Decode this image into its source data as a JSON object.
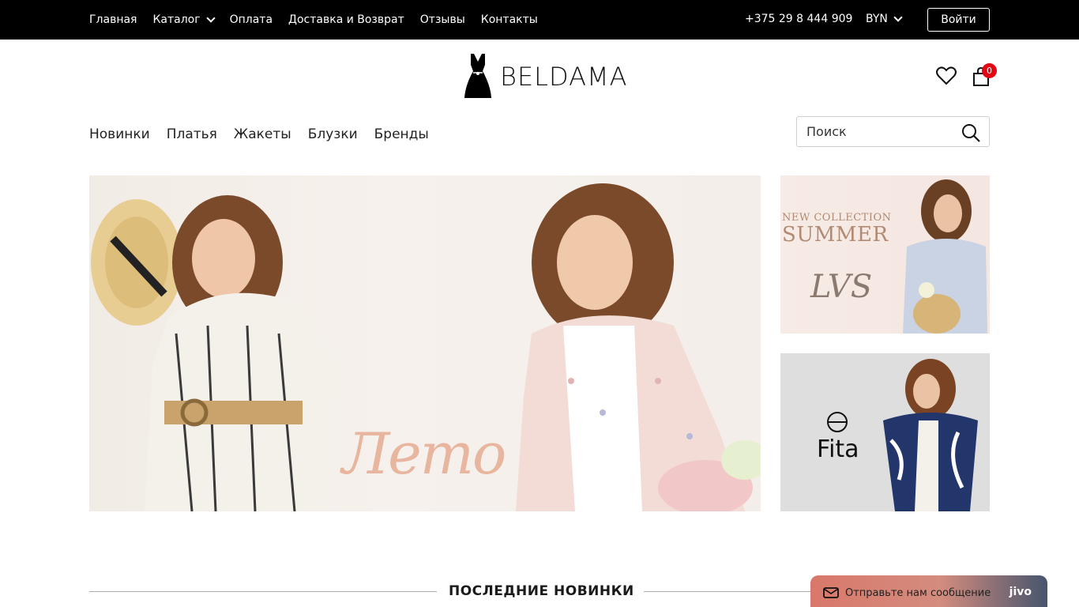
{
  "topbar": {
    "nav": [
      "Главная",
      "Каталог",
      "Оплата",
      "Доставка и Возврат",
      "Отзывы",
      "Контакты"
    ],
    "phone": "+375 29 8 444 909",
    "currency": "BYN",
    "login_label": "Войти"
  },
  "header": {
    "logo_text": "BELDAMA",
    "cart_count": "0"
  },
  "subnav": [
    "Новинки",
    "Платья",
    "Жакеты",
    "Блузки",
    "Бренды"
  ],
  "search": {
    "placeholder": "Поиск"
  },
  "banners": {
    "hero_text": "Лето",
    "side1_line1": "NEW COLLECTION",
    "side1_line2": "SUMMER",
    "side1_brand": "LVS",
    "side2_brand": "Fita"
  },
  "section": {
    "title": "ПОСЛЕДНИЕ НОВИНКИ"
  },
  "chat": {
    "label": "Отправьте нам сообщение",
    "brand": "jivo"
  },
  "colors": {
    "topbar_bg": "#000000",
    "badge": "#e30613",
    "accent_script": "#e8b59f"
  }
}
